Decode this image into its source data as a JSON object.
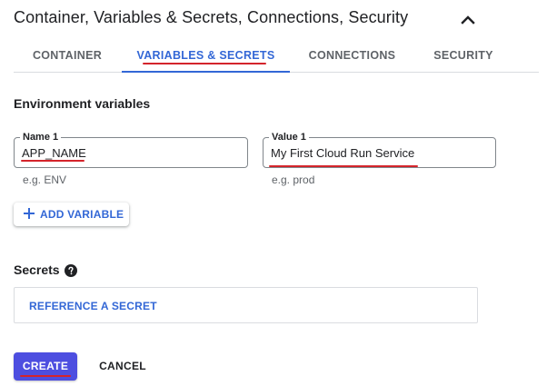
{
  "section": {
    "title": "Container, Variables & Secrets, Connections, Security"
  },
  "tabs": [
    {
      "label": "CONTAINER",
      "active": false
    },
    {
      "label": "VARIABLES & SECRETS",
      "active": true
    },
    {
      "label": "CONNECTIONS",
      "active": false
    },
    {
      "label": "SECURITY",
      "active": false
    }
  ],
  "env": {
    "heading": "Environment variables",
    "name_label": "Name 1",
    "name_value": "APP_NAME",
    "name_hint": "e.g. ENV",
    "value_label": "Value 1",
    "value_value": "My First Cloud Run Service",
    "value_hint": "e.g. prod",
    "add_label": "ADD VARIABLE"
  },
  "secrets": {
    "heading": "Secrets",
    "reference_label": "REFERENCE A SECRET"
  },
  "actions": {
    "create_label": "CREATE",
    "cancel_label": "CANCEL"
  },
  "colors": {
    "accent": "#3367d6",
    "primary_button": "#4d4ee0",
    "annotation_underline": "#d4242b"
  },
  "icons": {
    "collapse": "chevron-up-icon",
    "add": "plus-icon",
    "help": "help-circle-icon"
  }
}
